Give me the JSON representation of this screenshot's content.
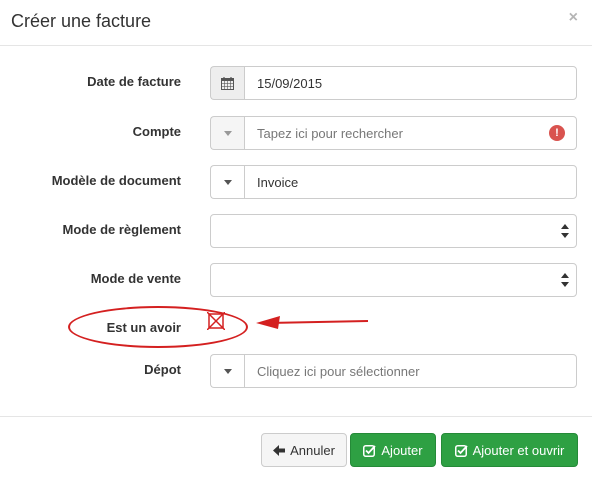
{
  "modal": {
    "title": "Créer une facture",
    "close_label": "×"
  },
  "fields": {
    "date": {
      "label": "Date de facture",
      "value": "15/09/2015",
      "icon": "calendar-icon"
    },
    "compte": {
      "label": "Compte",
      "placeholder": "Tapez ici pour rechercher",
      "error_icon": "!"
    },
    "modele": {
      "label": "Modèle de document",
      "value": "Invoice"
    },
    "reglement": {
      "label": "Mode de règlement",
      "value": ""
    },
    "vente": {
      "label": "Mode de vente",
      "value": ""
    },
    "avoir": {
      "label": "Est un avoir",
      "checked": false
    },
    "depot": {
      "label": "Dépot",
      "placeholder": "Cliquez ici pour sélectionner"
    }
  },
  "buttons": {
    "annuler": {
      "label": "Annuler",
      "icon": "arrow-left-icon"
    },
    "ajouter": {
      "label": "Ajouter",
      "icon": "check-square-icon"
    },
    "ajouter_ouvrir": {
      "label": "Ajouter et ouvrir",
      "icon": "check-square-icon"
    }
  },
  "colors": {
    "success": "#2ea043",
    "error": "#d9534f",
    "annotation": "#d42020"
  }
}
